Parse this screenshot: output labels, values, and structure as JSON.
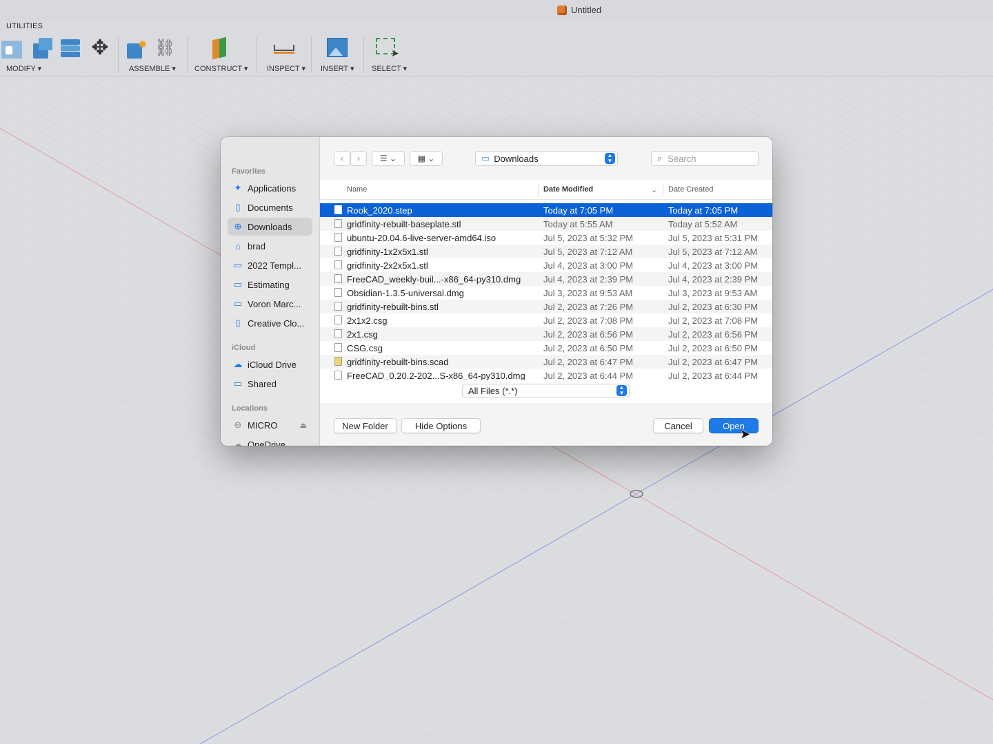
{
  "window": {
    "title": "Untitled"
  },
  "toolbar": {
    "tab": "UTILITIES",
    "groups": [
      "MODIFY ▾",
      "ASSEMBLE ▾",
      "CONSTRUCT ▾",
      "INSPECT ▾",
      "INSERT ▾",
      "SELECT ▾"
    ]
  },
  "dialog": {
    "sidebar": {
      "favorites_title": "Favorites",
      "favorites": [
        "Applications",
        "Documents",
        "Downloads",
        "brad",
        "2022 Templ...",
        "Estimating",
        "Voron Marc...",
        "Creative Clo..."
      ],
      "icloud_title": "iCloud",
      "icloud": [
        "iCloud Drive",
        "Shared"
      ],
      "locations_title": "Locations",
      "locations": [
        "MICRO",
        "OneDrive"
      ]
    },
    "location": "Downloads",
    "search_placeholder": "Search",
    "columns": {
      "name": "Name",
      "modified": "Date Modified",
      "created": "Date Created"
    },
    "files": [
      {
        "name": "Rook_2020.step",
        "modified": "Today at 7:05 PM",
        "created": "Today at 7:05 PM"
      },
      {
        "name": "gridfinity-rebuilt-baseplate.stl",
        "modified": "Today at 5:55 AM",
        "created": "Today at 5:52 AM"
      },
      {
        "name": "ubuntu-20.04.6-live-server-amd64.iso",
        "modified": "Jul 5, 2023 at 5:32 PM",
        "created": "Jul 5, 2023 at 5:31 PM"
      },
      {
        "name": "gridfinity-1x2x5x1.stl",
        "modified": "Jul 5, 2023 at 7:12 AM",
        "created": "Jul 5, 2023 at 7:12 AM"
      },
      {
        "name": "gridfinity-2x2x5x1.stl",
        "modified": "Jul 4, 2023 at 3:00 PM",
        "created": "Jul 4, 2023 at 3:00 PM"
      },
      {
        "name": "FreeCAD_weekly-buil...-x86_64-py310.dmg",
        "modified": "Jul 4, 2023 at 2:39 PM",
        "created": "Jul 4, 2023 at 2:39 PM"
      },
      {
        "name": "Obsidian-1.3.5-universal.dmg",
        "modified": "Jul 3, 2023 at 9:53 AM",
        "created": "Jul 3, 2023 at 9:53 AM"
      },
      {
        "name": "gridfinity-rebuilt-bins.stl",
        "modified": "Jul 2, 2023 at 7:26 PM",
        "created": "Jul 2, 2023 at 6:30 PM"
      },
      {
        "name": "2x1x2.csg",
        "modified": "Jul 2, 2023 at 7:08 PM",
        "created": "Jul 2, 2023 at 7:08 PM"
      },
      {
        "name": "2x1.csg",
        "modified": "Jul 2, 2023 at 6:56 PM",
        "created": "Jul 2, 2023 at 6:56 PM"
      },
      {
        "name": "CSG.csg",
        "modified": "Jul 2, 2023 at 6:50 PM",
        "created": "Jul 2, 2023 at 6:50 PM"
      },
      {
        "name": "gridfinity-rebuilt-bins.scad",
        "modified": "Jul 2, 2023 at 6:47 PM",
        "created": "Jul 2, 2023 at 6:47 PM"
      },
      {
        "name": "FreeCAD_0.20.2-202...S-x86_64-py310.dmg",
        "modified": "Jul 2, 2023 at 6:44 PM",
        "created": "Jul 2, 2023 at 6:44 PM"
      }
    ],
    "filter": "All Files (*.*)",
    "buttons": {
      "new_folder": "New Folder",
      "hide_options": "Hide Options",
      "cancel": "Cancel",
      "open": "Open"
    }
  },
  "colors": {
    "accent": "#1e7ae6",
    "selection": "#0a62d6"
  }
}
